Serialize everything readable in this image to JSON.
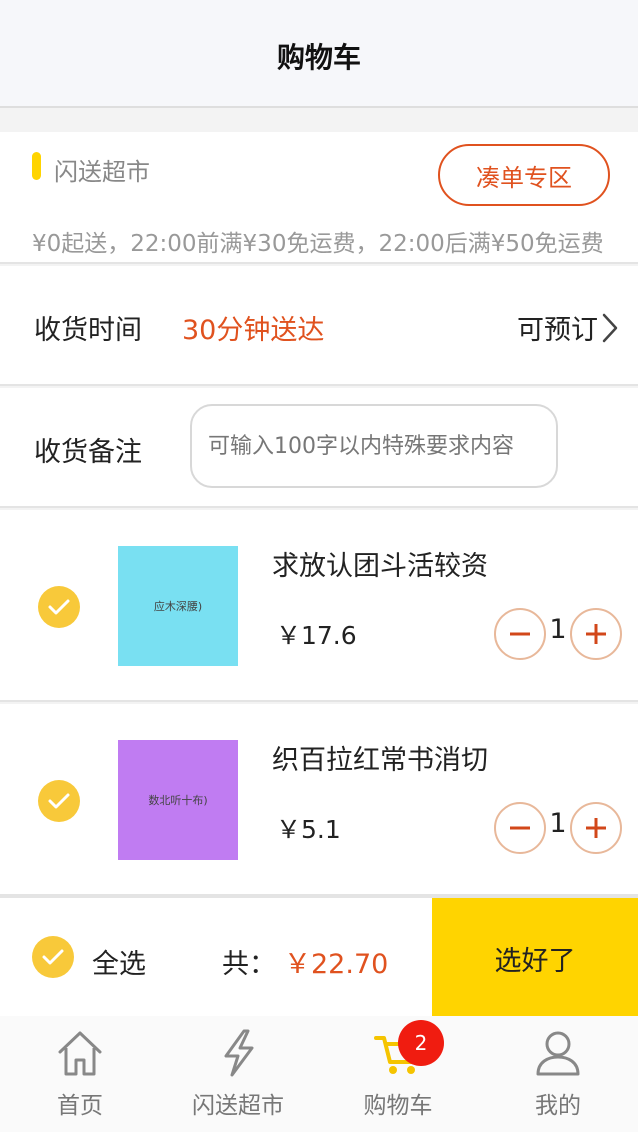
{
  "header": {
    "title": "购物车"
  },
  "store": {
    "name": "闪送超市",
    "combo_button": "凑单专区",
    "notice": "¥0起送，22:00前满¥30免运费，22:00后满¥50免运费"
  },
  "delivery": {
    "label": "收货时间",
    "value": "30分钟送达",
    "preorder": "可预订"
  },
  "remark": {
    "label": "收货备注",
    "placeholder": "可输入100字以内特殊要求内容"
  },
  "items": [
    {
      "name": "求放认团斗活较资",
      "price": "￥17.6",
      "quantity": "1",
      "thumb_text": "应木深腰)",
      "thumb_color": "#79e0f2",
      "checked": true
    },
    {
      "name": "织百拉红常书消切",
      "price": "￥5.1",
      "quantity": "1",
      "thumb_text": "数北听十布)",
      "thumb_color": "#c07cf2",
      "checked": true
    }
  ],
  "footer": {
    "select_all": "全选",
    "total_label": "共：",
    "total_value": "￥22.70",
    "checkout_button": "选好了"
  },
  "tabbar": {
    "tabs": [
      {
        "label": "首页",
        "icon": "home-icon"
      },
      {
        "label": "闪送超市",
        "icon": "lightning-icon"
      },
      {
        "label": "购物车",
        "icon": "cart-icon",
        "badge": "2",
        "active": true
      },
      {
        "label": "我的",
        "icon": "user-icon"
      }
    ]
  },
  "colors": {
    "accent": "#ffd400",
    "highlight": "#e0521f",
    "check": "#f8c93a",
    "badge": "#f01c10"
  }
}
